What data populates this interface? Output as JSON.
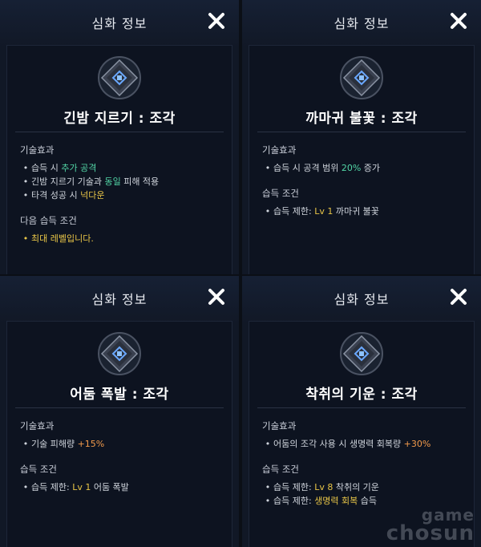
{
  "colors": {
    "green": "#52d6a6",
    "yellow": "#e8c547",
    "orange": "#f29a4b",
    "panel_bg": "#111826"
  },
  "panels": [
    {
      "header": "심화 정보",
      "skill_name": "긴밤 지르기 : 조각",
      "section1": {
        "title": "기술효과",
        "lines": [
          {
            "pre": "습득 시 ",
            "hl": "추가 공격",
            "post": ""
          },
          {
            "pre": "긴밤 지르기 기술과 ",
            "hl": "동일",
            "post": " 피해 적용"
          },
          {
            "pre": "타격 성공 시 ",
            "hl": "넉다운",
            "post": ""
          }
        ]
      },
      "section2": {
        "title": "다음 습득 조건",
        "lines": [
          {
            "pre": "",
            "hl": "최대 레벨입니다.",
            "post": ""
          }
        ]
      }
    },
    {
      "header": "심화 정보",
      "skill_name": "까마귀 불꽃 : 조각",
      "section1": {
        "title": "기술효과",
        "lines": [
          {
            "pre": "습득 시 공격 범위 ",
            "hl": "20%",
            "post": " 증가"
          }
        ]
      },
      "section2": {
        "title": "습득 조건",
        "lines": [
          {
            "pre": "습득 제한: ",
            "hl": "Lv 1",
            "post": " 까마귀 불꽃"
          }
        ]
      }
    },
    {
      "header": "심화 정보",
      "skill_name": "어둠 폭발 : 조각",
      "section1": {
        "title": "기술효과",
        "lines": [
          {
            "pre": "기술 피해량 ",
            "hl": "+15%",
            "post": ""
          }
        ]
      },
      "section2": {
        "title": "습득 조건",
        "lines": [
          {
            "pre": "습득 제한: ",
            "hl": "Lv 1",
            "post": " 어둠 폭발"
          }
        ]
      }
    },
    {
      "header": "심화 정보",
      "skill_name": "착취의 기운 : 조각",
      "section1": {
        "title": "기술효과",
        "lines": [
          {
            "pre": "어둠의 조각 사용 시 생명력 회복량 ",
            "hl": "+30%",
            "post": ""
          }
        ]
      },
      "section2": {
        "title": "습득 조건",
        "lines": [
          {
            "pre": "습득 제한: ",
            "hl": "Lv 8",
            "post": " 착취의 기운"
          },
          {
            "pre": "습득 제한: ",
            "hl": "생명력 회복",
            "post": " 습득"
          }
        ]
      }
    }
  ],
  "watermark": {
    "line1": "game",
    "line2": "chosun"
  }
}
